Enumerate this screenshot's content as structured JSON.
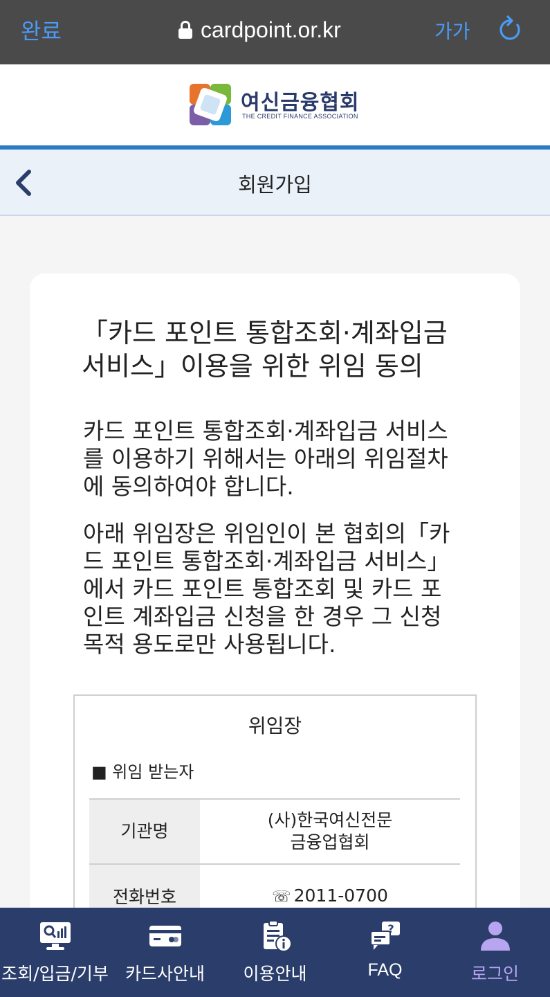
{
  "browser": {
    "done_label": "완료",
    "url": "cardpoint.or.kr",
    "text_size_label": "가가"
  },
  "header": {
    "logo_title": "여신금융협회",
    "logo_subtitle": "THE CREDIT FINANCE ASSOCIATION"
  },
  "title_bar": {
    "title": "회원가입"
  },
  "content": {
    "heading_line1": "「카드 포인트 통합조회·계좌입금",
    "heading_line2": "서비스」이용을 위한 위임 동의",
    "para1_lines": [
      "카드 포인트 통합조회·계좌입금 서비스",
      "를 이용하기 위해서는 아래의 위임절차",
      "에 동의하여야 합니다."
    ],
    "para2_lines": [
      "아래 위임장은 위임인이 본 협회의「카",
      "드 포인트 통합조회·계좌입금 서비스」",
      "에서 카드 포인트 통합조회 및 카드 포",
      "인트 계좌입금 신청을 한 경우 그 신청",
      "목적 용도로만 사용됩니다."
    ]
  },
  "doc": {
    "title": "위임장",
    "section_label": "■ 위임 받는자",
    "rows": [
      {
        "label": "기관명",
        "value_line1": "(사)한국여신전문",
        "value_line2": "금융업협회"
      },
      {
        "label": "전화번호",
        "value": "2011-0700"
      }
    ]
  },
  "bottom_nav": {
    "items": [
      {
        "label": "조회/입금/기부",
        "icon": "inquiry-icon"
      },
      {
        "label": "카드사안내",
        "icon": "card-icon"
      },
      {
        "label": "이용안내",
        "icon": "guide-icon"
      },
      {
        "label": "FAQ",
        "icon": "faq-icon"
      },
      {
        "label": "로그인",
        "icon": "user-icon"
      }
    ],
    "active_index": 4
  },
  "colors": {
    "nav_bg": "#2a3d6b",
    "accent_blue": "#2c7bc2",
    "active_purple": "#b7a5f0",
    "browser_link": "#4a9bf5"
  }
}
